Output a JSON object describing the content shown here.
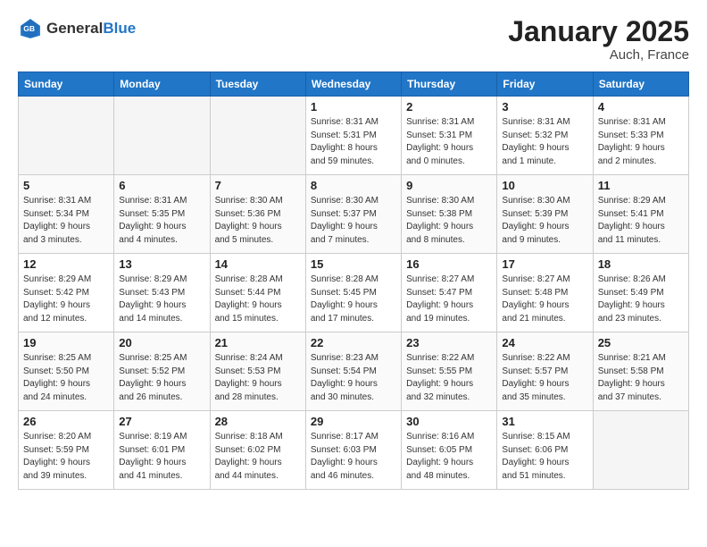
{
  "header": {
    "logo_general": "General",
    "logo_blue": "Blue",
    "month_title": "January 2025",
    "location": "Auch, France"
  },
  "weekdays": [
    "Sunday",
    "Monday",
    "Tuesday",
    "Wednesday",
    "Thursday",
    "Friday",
    "Saturday"
  ],
  "weeks": [
    [
      {
        "day": "",
        "info": ""
      },
      {
        "day": "",
        "info": ""
      },
      {
        "day": "",
        "info": ""
      },
      {
        "day": "1",
        "info": "Sunrise: 8:31 AM\nSunset: 5:31 PM\nDaylight: 8 hours\nand 59 minutes."
      },
      {
        "day": "2",
        "info": "Sunrise: 8:31 AM\nSunset: 5:31 PM\nDaylight: 9 hours\nand 0 minutes."
      },
      {
        "day": "3",
        "info": "Sunrise: 8:31 AM\nSunset: 5:32 PM\nDaylight: 9 hours\nand 1 minute."
      },
      {
        "day": "4",
        "info": "Sunrise: 8:31 AM\nSunset: 5:33 PM\nDaylight: 9 hours\nand 2 minutes."
      }
    ],
    [
      {
        "day": "5",
        "info": "Sunrise: 8:31 AM\nSunset: 5:34 PM\nDaylight: 9 hours\nand 3 minutes."
      },
      {
        "day": "6",
        "info": "Sunrise: 8:31 AM\nSunset: 5:35 PM\nDaylight: 9 hours\nand 4 minutes."
      },
      {
        "day": "7",
        "info": "Sunrise: 8:30 AM\nSunset: 5:36 PM\nDaylight: 9 hours\nand 5 minutes."
      },
      {
        "day": "8",
        "info": "Sunrise: 8:30 AM\nSunset: 5:37 PM\nDaylight: 9 hours\nand 7 minutes."
      },
      {
        "day": "9",
        "info": "Sunrise: 8:30 AM\nSunset: 5:38 PM\nDaylight: 9 hours\nand 8 minutes."
      },
      {
        "day": "10",
        "info": "Sunrise: 8:30 AM\nSunset: 5:39 PM\nDaylight: 9 hours\nand 9 minutes."
      },
      {
        "day": "11",
        "info": "Sunrise: 8:29 AM\nSunset: 5:41 PM\nDaylight: 9 hours\nand 11 minutes."
      }
    ],
    [
      {
        "day": "12",
        "info": "Sunrise: 8:29 AM\nSunset: 5:42 PM\nDaylight: 9 hours\nand 12 minutes."
      },
      {
        "day": "13",
        "info": "Sunrise: 8:29 AM\nSunset: 5:43 PM\nDaylight: 9 hours\nand 14 minutes."
      },
      {
        "day": "14",
        "info": "Sunrise: 8:28 AM\nSunset: 5:44 PM\nDaylight: 9 hours\nand 15 minutes."
      },
      {
        "day": "15",
        "info": "Sunrise: 8:28 AM\nSunset: 5:45 PM\nDaylight: 9 hours\nand 17 minutes."
      },
      {
        "day": "16",
        "info": "Sunrise: 8:27 AM\nSunset: 5:47 PM\nDaylight: 9 hours\nand 19 minutes."
      },
      {
        "day": "17",
        "info": "Sunrise: 8:27 AM\nSunset: 5:48 PM\nDaylight: 9 hours\nand 21 minutes."
      },
      {
        "day": "18",
        "info": "Sunrise: 8:26 AM\nSunset: 5:49 PM\nDaylight: 9 hours\nand 23 minutes."
      }
    ],
    [
      {
        "day": "19",
        "info": "Sunrise: 8:25 AM\nSunset: 5:50 PM\nDaylight: 9 hours\nand 24 minutes."
      },
      {
        "day": "20",
        "info": "Sunrise: 8:25 AM\nSunset: 5:52 PM\nDaylight: 9 hours\nand 26 minutes."
      },
      {
        "day": "21",
        "info": "Sunrise: 8:24 AM\nSunset: 5:53 PM\nDaylight: 9 hours\nand 28 minutes."
      },
      {
        "day": "22",
        "info": "Sunrise: 8:23 AM\nSunset: 5:54 PM\nDaylight: 9 hours\nand 30 minutes."
      },
      {
        "day": "23",
        "info": "Sunrise: 8:22 AM\nSunset: 5:55 PM\nDaylight: 9 hours\nand 32 minutes."
      },
      {
        "day": "24",
        "info": "Sunrise: 8:22 AM\nSunset: 5:57 PM\nDaylight: 9 hours\nand 35 minutes."
      },
      {
        "day": "25",
        "info": "Sunrise: 8:21 AM\nSunset: 5:58 PM\nDaylight: 9 hours\nand 37 minutes."
      }
    ],
    [
      {
        "day": "26",
        "info": "Sunrise: 8:20 AM\nSunset: 5:59 PM\nDaylight: 9 hours\nand 39 minutes."
      },
      {
        "day": "27",
        "info": "Sunrise: 8:19 AM\nSunset: 6:01 PM\nDaylight: 9 hours\nand 41 minutes."
      },
      {
        "day": "28",
        "info": "Sunrise: 8:18 AM\nSunset: 6:02 PM\nDaylight: 9 hours\nand 44 minutes."
      },
      {
        "day": "29",
        "info": "Sunrise: 8:17 AM\nSunset: 6:03 PM\nDaylight: 9 hours\nand 46 minutes."
      },
      {
        "day": "30",
        "info": "Sunrise: 8:16 AM\nSunset: 6:05 PM\nDaylight: 9 hours\nand 48 minutes."
      },
      {
        "day": "31",
        "info": "Sunrise: 8:15 AM\nSunset: 6:06 PM\nDaylight: 9 hours\nand 51 minutes."
      },
      {
        "day": "",
        "info": ""
      }
    ]
  ]
}
